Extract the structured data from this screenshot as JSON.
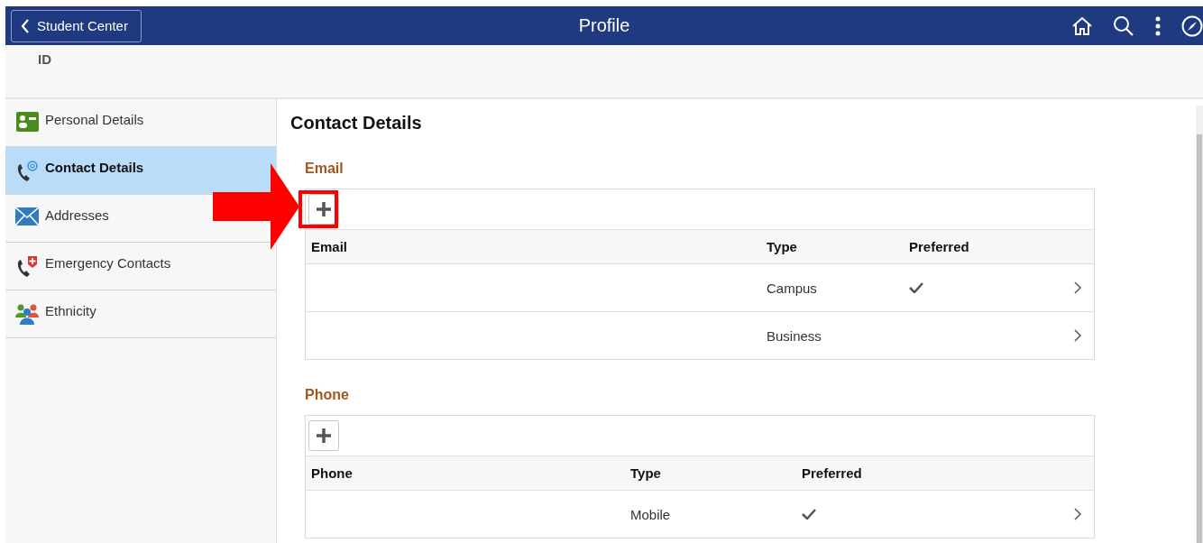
{
  "header": {
    "back_button": "Student Center",
    "title": "Profile"
  },
  "subheader": {
    "label": "ID"
  },
  "sidebar": {
    "items": [
      {
        "label": "Personal Details",
        "selected": false
      },
      {
        "label": "Contact Details",
        "selected": true
      },
      {
        "label": "Addresses",
        "selected": false
      },
      {
        "label": "Emergency Contacts",
        "selected": false
      },
      {
        "label": "Ethnicity",
        "selected": false
      }
    ]
  },
  "page_title": "Contact Details",
  "sections": [
    {
      "title": "Email",
      "highlighted": true,
      "columns": [
        "Email",
        "Type",
        "Preferred"
      ],
      "rows": [
        {
          "type": "Campus",
          "preferred": true
        },
        {
          "type": "Business",
          "preferred": false
        }
      ]
    },
    {
      "title": "Phone",
      "highlighted": false,
      "columns": [
        "Phone",
        "Type",
        "Preferred"
      ],
      "rows": [
        {
          "type": "Mobile",
          "preferred": true
        }
      ]
    }
  ]
}
